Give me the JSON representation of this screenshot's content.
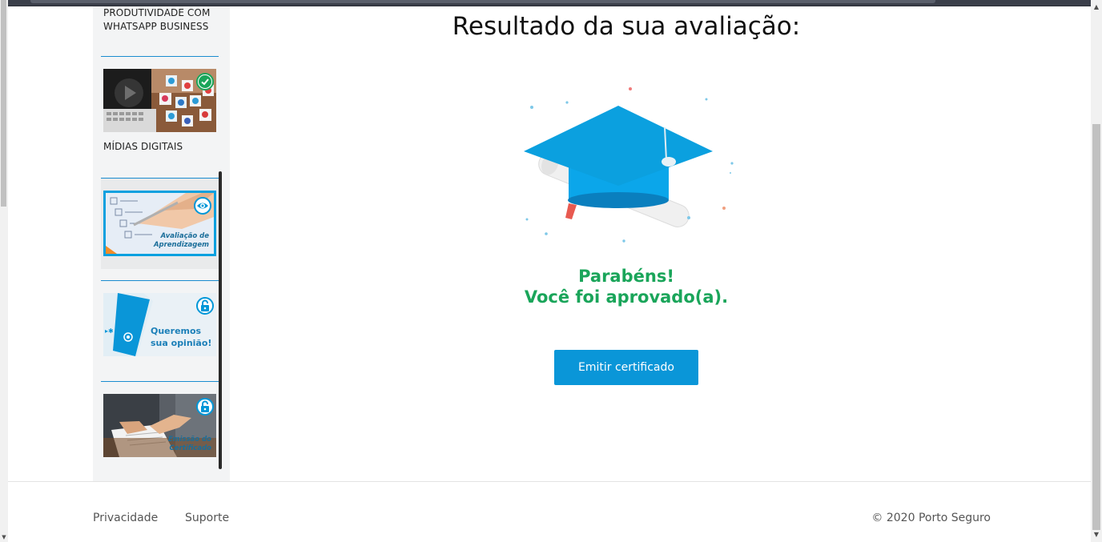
{
  "sidebar": {
    "modules": [
      {
        "title_line1": "PRODUTIVIDADE COM",
        "title_line2": "WHATSAPP BUSINESS"
      },
      {
        "title": "MÍDIAS DIGITAIS",
        "status": "completed"
      },
      {
        "caption_line1": "Avaliação de",
        "caption_line2": "Aprendizagem",
        "status": "viewing"
      },
      {
        "caption_line1": "Queremos",
        "caption_line2": "sua opinião!",
        "status": "locked"
      },
      {
        "caption_line1": "Emissão do",
        "caption_line2": "Certificado",
        "status": "locked"
      }
    ]
  },
  "main": {
    "title": "Resultado da sua avaliação:",
    "congrats_line1": "Parabéns!",
    "congrats_line2": "Você foi aprovado(a).",
    "cert_button": "Emitir certificado"
  },
  "footer": {
    "links": [
      "Privacidade",
      "Suporte"
    ],
    "copyright": "© 2020 Porto Seguro"
  },
  "colors": {
    "accent": "#0a96d8",
    "success": "#1aa55a",
    "sidebar_bg": "#f3f4f5",
    "separator": "#1a8ccf"
  },
  "icons": {
    "completed": "check-circle-icon",
    "viewing": "eye-icon",
    "locked": "lock-icon",
    "hero": "graduation-cap-icon"
  }
}
